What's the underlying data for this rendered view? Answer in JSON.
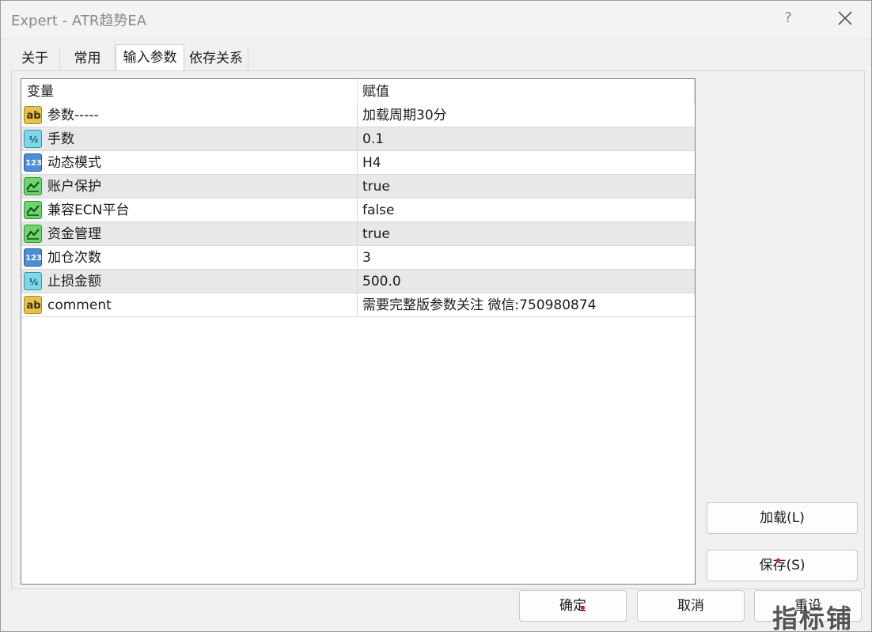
{
  "window": {
    "title": "Expert - ATR趋势EA",
    "help_label": "?"
  },
  "tabs": [
    {
      "label": "关于"
    },
    {
      "label": "常用"
    },
    {
      "label": "输入参数",
      "active": true
    },
    {
      "label": "依存关系"
    }
  ],
  "table": {
    "headers": {
      "variable": "变量",
      "value": "赋值"
    },
    "rows": [
      {
        "icon": "string-type-icon",
        "icon_text": "ab",
        "variable": "参数-----",
        "value": "加载周期30分"
      },
      {
        "icon": "double-type-icon",
        "icon_text": "½",
        "variable": "手数",
        "value": "0.1"
      },
      {
        "icon": "int-type-icon",
        "icon_text": "123",
        "variable": "动态模式",
        "value": "H4"
      },
      {
        "icon": "bool-type-icon",
        "icon_text": "",
        "variable": "账户保护",
        "value": "true"
      },
      {
        "icon": "bool-type-icon",
        "icon_text": "",
        "variable": "兼容ECN平台",
        "value": "false"
      },
      {
        "icon": "bool-type-icon",
        "icon_text": "",
        "variable": "资金管理",
        "value": "true"
      },
      {
        "icon": "int-type-icon",
        "icon_text": "123",
        "variable": "加仓次数",
        "value": "3"
      },
      {
        "icon": "double-type-icon",
        "icon_text": "½",
        "variable": "止损金额",
        "value": "500.0"
      },
      {
        "icon": "string-type-icon",
        "icon_text": "ab",
        "variable": "comment",
        "value": "需要完整版参数关注 微信:750980874"
      }
    ]
  },
  "side_buttons": {
    "load_label": "加载(L)",
    "save_label": "保存(S)"
  },
  "footer_buttons": {
    "ok_label": "确定",
    "cancel_label": "取消",
    "reset_label": "重设"
  },
  "watermark": {
    "text": "指标铺"
  },
  "colors": {
    "row_alt": "#e8e8e8",
    "string_icon": "#e6c24d",
    "double_icon": "#7fd6e8",
    "int_icon": "#4d8fd6",
    "bool_icon": "#6fd46f"
  }
}
